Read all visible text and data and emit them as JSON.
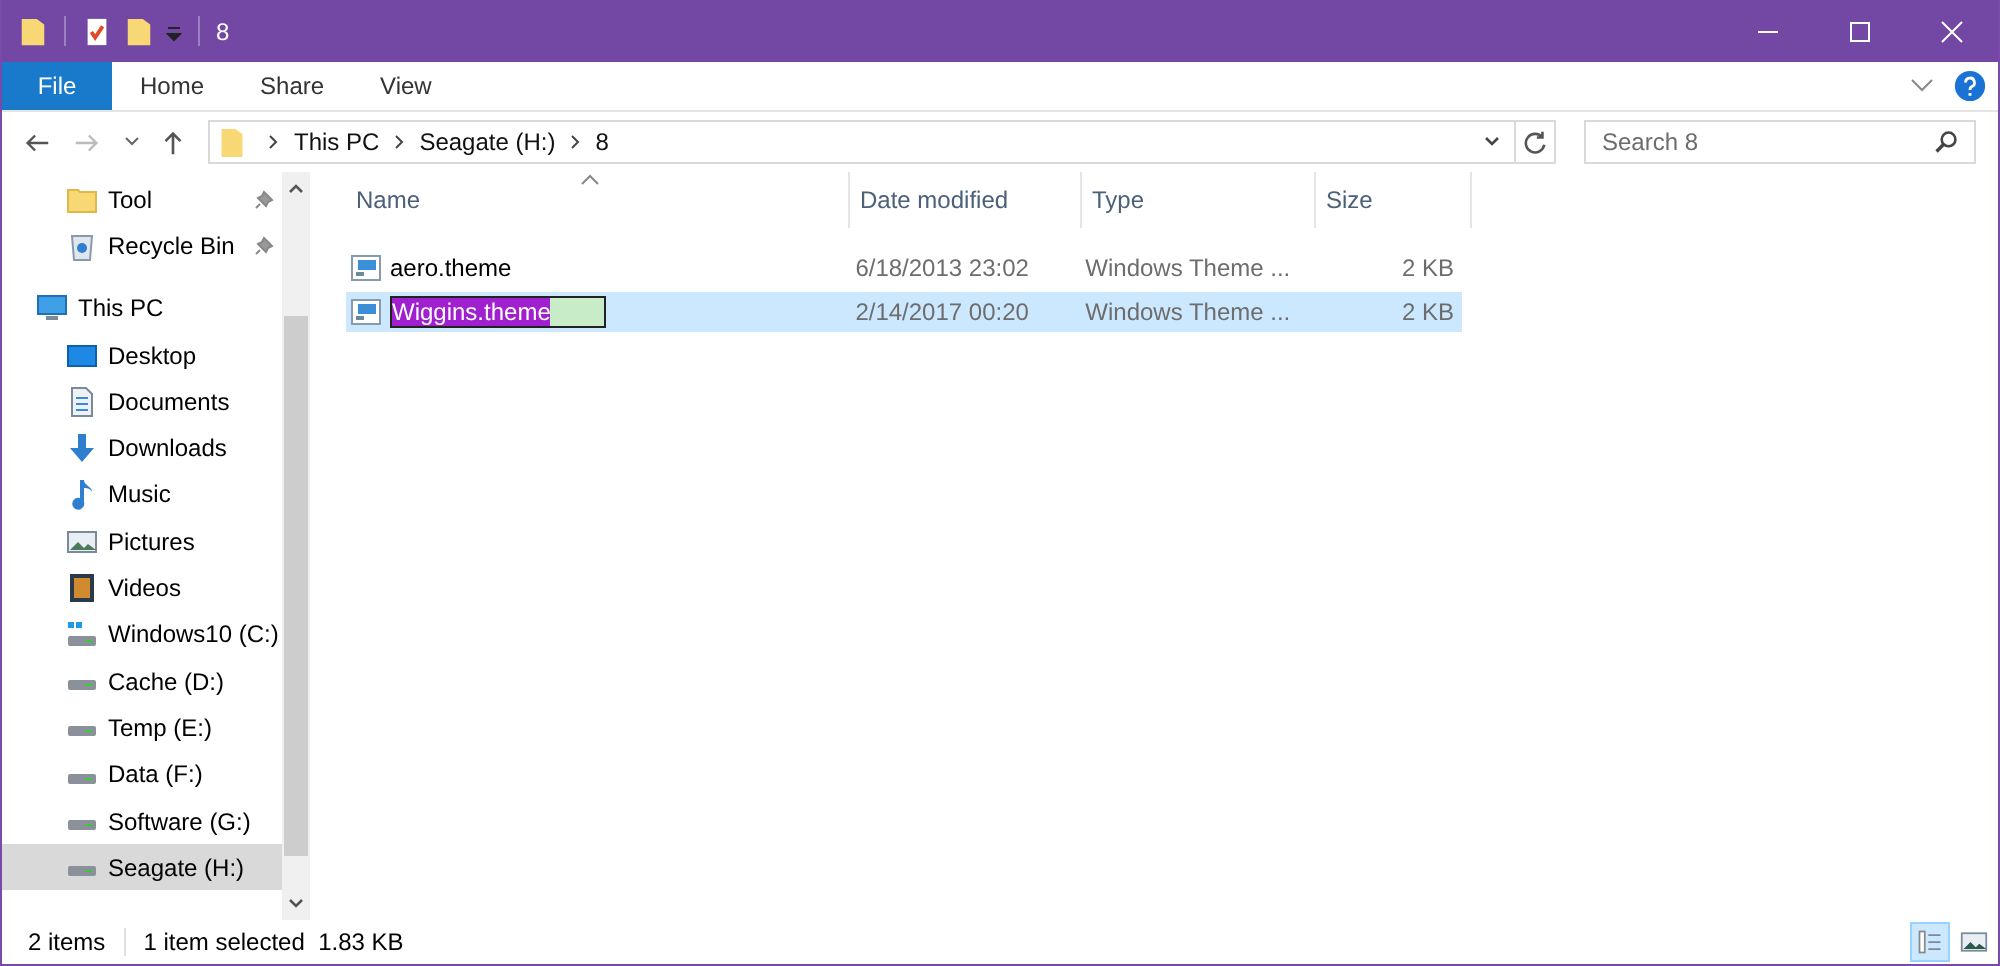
{
  "window": {
    "title": "8"
  },
  "ribbon_tabs": [
    {
      "label": "File",
      "kind": "file",
      "selected": false
    },
    {
      "label": "Home",
      "kind": "tab",
      "selected": false
    },
    {
      "label": "Share",
      "kind": "tab",
      "selected": false
    },
    {
      "label": "View",
      "kind": "tab",
      "selected": false
    }
  ],
  "address": {
    "crumbs": [
      "This PC",
      "Seagate (H:)",
      "8"
    ]
  },
  "search": {
    "placeholder": "Search 8"
  },
  "sidebar": {
    "items": [
      {
        "label": "Tool",
        "kind": "folder",
        "pinned": true,
        "selected": false
      },
      {
        "label": "Recycle Bin",
        "kind": "recycle",
        "pinned": true,
        "selected": false
      },
      {
        "label": "This PC",
        "kind": "pc",
        "pinned": false,
        "selected": false,
        "children": [
          {
            "label": "Desktop",
            "kind": "desktop",
            "selected": false
          },
          {
            "label": "Documents",
            "kind": "documents",
            "selected": false
          },
          {
            "label": "Downloads",
            "kind": "downloads",
            "selected": false
          },
          {
            "label": "Music",
            "kind": "music",
            "selected": false
          },
          {
            "label": "Pictures",
            "kind": "pictures",
            "selected": false
          },
          {
            "label": "Videos",
            "kind": "videos",
            "selected": false
          },
          {
            "label": "Windows10 (C:)",
            "kind": "windrive",
            "selected": false
          },
          {
            "label": "Cache (D:)",
            "kind": "drive",
            "selected": false
          },
          {
            "label": "Temp (E:)",
            "kind": "drive",
            "selected": false
          },
          {
            "label": "Data (F:)",
            "kind": "drive",
            "selected": false
          },
          {
            "label": "Software (G:)",
            "kind": "drive",
            "selected": false
          },
          {
            "label": "Seagate (H:)",
            "kind": "drive",
            "selected": true
          }
        ]
      }
    ]
  },
  "table": {
    "columns": [
      "Name",
      "Date modified",
      "Type",
      "Size"
    ],
    "rows": [
      {
        "name": "aero.theme",
        "date": "6/18/2013 23:02",
        "type": "Windows Theme ...",
        "size": "2 KB",
        "selected": false,
        "renaming": false
      },
      {
        "name": "Wiggins.theme",
        "date": "2/14/2017 00:20",
        "type": "Windows Theme ...",
        "size": "2 KB",
        "selected": true,
        "renaming": true
      }
    ]
  },
  "status_bar": {
    "items": "2 items",
    "selection": "1 item selected  1.83 KB",
    "view_buttons": [
      {
        "kind": "details",
        "selected": true
      },
      {
        "kind": "thumbnails",
        "selected": false
      }
    ]
  }
}
